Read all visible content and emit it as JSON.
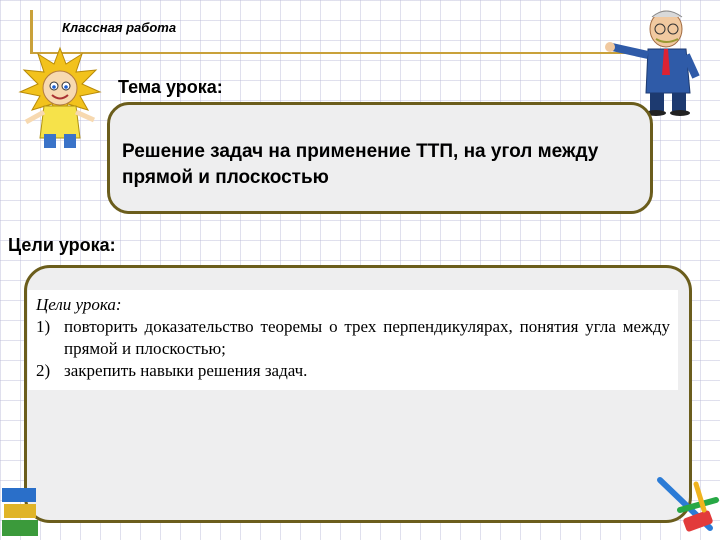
{
  "header": {
    "label": "Классная  работа"
  },
  "topic": {
    "label": "Тема урока:",
    "text": "Решение задач на применение ТТП, на угол между прямой и плоскостью"
  },
  "goals": {
    "label": "Цели урока:",
    "paper_title": "Цели урока:",
    "items": [
      {
        "num": "1)",
        "text": "повторить доказательство теоремы о трех перпендикулярах, понятия угла между прямой и плоскостью;"
      },
      {
        "num": "2)",
        "text": "закрепить навыки решения задач."
      }
    ]
  }
}
